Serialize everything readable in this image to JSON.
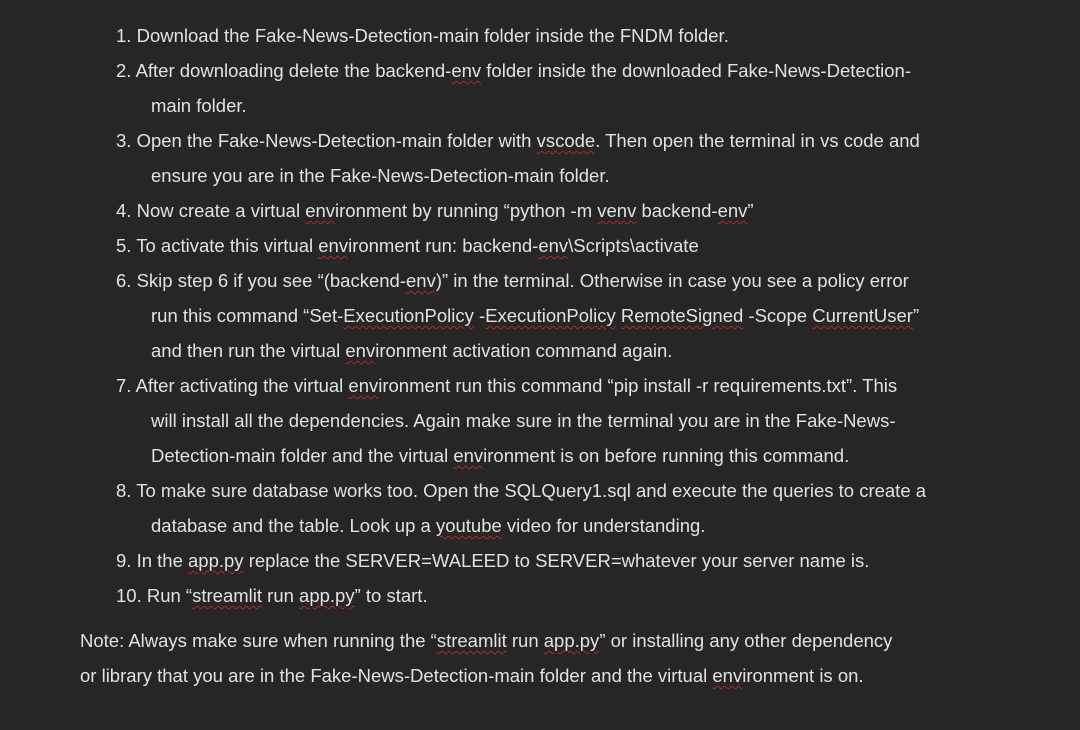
{
  "steps": [
    {
      "num": "1.",
      "lines": [
        "Download the Fake-News-Detection-main folder inside the FNDM folder."
      ]
    },
    {
      "num": "2.",
      "lines": [
        "After downloading delete the backend-env folder inside the downloaded Fake-News-Detection-",
        "main folder."
      ]
    },
    {
      "num": "3.",
      "lines": [
        "Open the Fake-News-Detection-main folder with vscode. Then open the terminal in vs code and",
        "ensure you are in the Fake-News-Detection-main folder."
      ]
    },
    {
      "num": "4.",
      "lines": [
        "Now create a virtual environment by running “python -m venv backend-env”"
      ]
    },
    {
      "num": "5.",
      "lines": [
        "To activate this virtual environment run: backend-env\\Scripts\\activate"
      ]
    },
    {
      "num": "6.",
      "lines": [
        "Skip step 6 if you see “(backend-env)” in the terminal. Otherwise in case you see a policy error",
        "run this command “Set-ExecutionPolicy -ExecutionPolicy RemoteSigned -Scope CurrentUser”",
        "and then run the virtual environment activation command again."
      ]
    },
    {
      "num": "7.",
      "lines": [
        "After activating the virtual environment run this command “pip install -r requirements.txt”. This",
        "will install all the dependencies. Again make sure in the terminal you are in the Fake-News-",
        "Detection-main folder and the virtual environment is on before running this command."
      ]
    },
    {
      "num": "8.",
      "lines": [
        "To make sure database works too. Open the SQLQuery1.sql and execute the queries to create a",
        "database and the table. Look up a youtube video for understanding."
      ]
    },
    {
      "num": "9.",
      "lines": [
        "In the app.py replace the SERVER=WALEED to SERVER=whatever your server name is."
      ]
    },
    {
      "num": "10.",
      "lines": [
        "Run “streamlit run app.py” to start."
      ]
    }
  ],
  "note": {
    "lines": [
      "Note: Always make sure when running the “streamlit run app.py” or installing any other dependency",
      "or library that you are in the Fake-News-Detection-main folder and the virtual environment is on."
    ]
  },
  "spellcheck_words": [
    "env",
    "vscode",
    "venv",
    "ExecutionPolicy",
    "RemoteSigned",
    "CurrentUser",
    "youtube",
    "streamlit",
    "app.py"
  ],
  "colors": {
    "background": "#262626",
    "text": "#e2e2e2",
    "spellcheck_underline": "#b3261e"
  }
}
